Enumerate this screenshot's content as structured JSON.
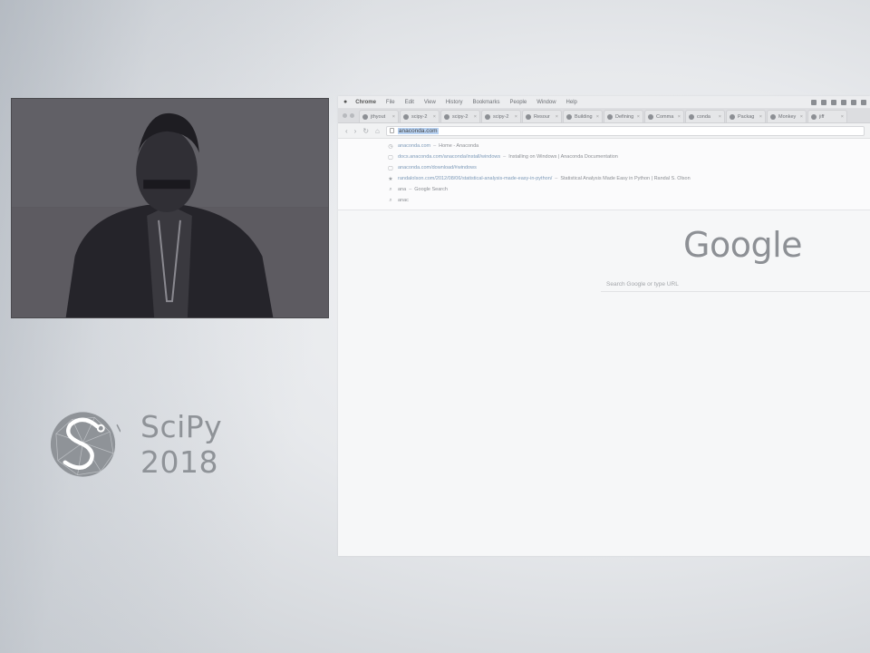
{
  "webcam": {
    "label": "speaker"
  },
  "branding": {
    "logo_text": "SciPy 2018"
  },
  "browser": {
    "menu": [
      "Chrome",
      "File",
      "Edit",
      "View",
      "History",
      "Bookmarks",
      "People",
      "Window",
      "Help"
    ],
    "tabs": [
      "jthyout",
      "scipy-2",
      "scipy-2",
      "scipy-2",
      "Resour",
      "Building",
      "Defining",
      "Comma",
      "conda",
      "Packag",
      "Monkey",
      "jiff"
    ],
    "address": "anaconda.com",
    "suggestions": [
      {
        "icon": "clock-icon",
        "url": "anaconda.com",
        "title": "Home - Anaconda"
      },
      {
        "icon": "page-icon",
        "url": "docs.anaconda.com/anaconda/install/windows",
        "title": "Installing on Windows | Anaconda Documentation"
      },
      {
        "icon": "page-icon",
        "url": "anaconda.com/download/#windows",
        "title": ""
      },
      {
        "icon": "star-icon",
        "url": "randalolson.com/2012/08/06/statistical-analysis-made-easy-in-python/",
        "title": "Statistical Analysis Made Easy in Python | Randal S. Olson"
      },
      {
        "icon": "search-icon",
        "url": "ana",
        "title": "Google Search"
      },
      {
        "icon": "search-icon",
        "url": "anac",
        "title": ""
      }
    ],
    "google_logo": "Google",
    "search_placeholder": "Search Google or type URL"
  }
}
